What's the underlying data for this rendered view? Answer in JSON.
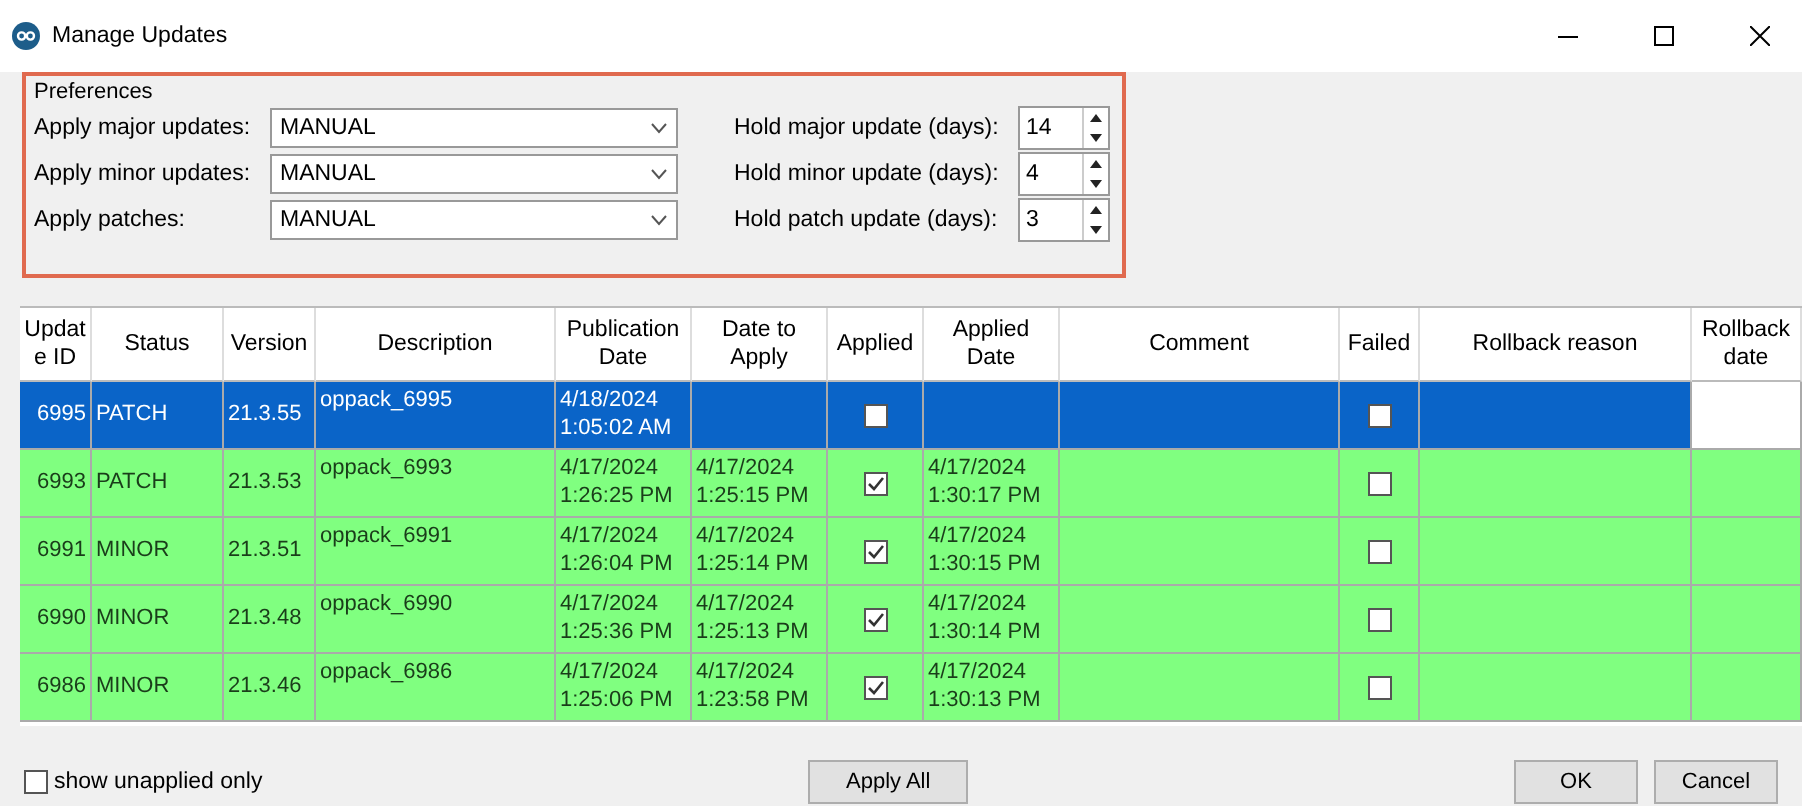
{
  "window": {
    "title": "Manage Updates"
  },
  "preferences": {
    "title": "Preferences",
    "apply": [
      {
        "label": "Apply major updates:",
        "value": "MANUAL"
      },
      {
        "label": "Apply minor updates:",
        "value": "MANUAL"
      },
      {
        "label": "Apply patches:",
        "value": "MANUAL"
      }
    ],
    "hold": [
      {
        "label": "Hold major update (days):",
        "value": "14"
      },
      {
        "label": "Hold minor update (days):",
        "value": "4"
      },
      {
        "label": "Hold patch update (days):",
        "value": "3"
      }
    ]
  },
  "table": {
    "columns": [
      "Update ID",
      "Status",
      "Version",
      "Description",
      "Publication Date",
      "Date to Apply",
      "Applied",
      "Applied Date",
      "Comment",
      "Failed",
      "Rollback reason",
      "Rollback date"
    ],
    "rows": [
      {
        "id": "6995",
        "status": "PATCH",
        "version": "21.3.55",
        "description": "oppack_6995",
        "publication_date": "4/18/2024 1:05:02 AM",
        "date_to_apply": "",
        "applied": false,
        "applied_date": "",
        "failed": false,
        "selected": true
      },
      {
        "id": "6993",
        "status": "PATCH",
        "version": "21.3.53",
        "description": "oppack_6993",
        "publication_date": "4/17/2024 1:26:25 PM",
        "date_to_apply": "4/17/2024 1:25:15 PM",
        "applied": true,
        "applied_date": "4/17/2024 1:30:17 PM",
        "failed": false,
        "selected": false
      },
      {
        "id": "6991",
        "status": "MINOR",
        "version": "21.3.51",
        "description": "oppack_6991",
        "publication_date": "4/17/2024 1:26:04 PM",
        "date_to_apply": "4/17/2024 1:25:14 PM",
        "applied": true,
        "applied_date": "4/17/2024 1:30:15 PM",
        "failed": false,
        "selected": false
      },
      {
        "id": "6990",
        "status": "MINOR",
        "version": "21.3.48",
        "description": "oppack_6990",
        "publication_date": "4/17/2024 1:25:36 PM",
        "date_to_apply": "4/17/2024 1:25:13 PM",
        "applied": true,
        "applied_date": "4/17/2024 1:30:14 PM",
        "failed": false,
        "selected": false
      },
      {
        "id": "6986",
        "status": "MINOR",
        "version": "21.3.46",
        "description": "oppack_6986",
        "publication_date": "4/17/2024 1:25:06 PM",
        "date_to_apply": "4/17/2024 1:23:58 PM",
        "applied": true,
        "applied_date": "4/17/2024 1:30:13 PM",
        "failed": false,
        "selected": false
      }
    ]
  },
  "footer": {
    "show_unapplied": {
      "label": "show unapplied only",
      "checked": false
    },
    "apply_all": "Apply All",
    "ok": "OK",
    "cancel": "Cancel"
  }
}
